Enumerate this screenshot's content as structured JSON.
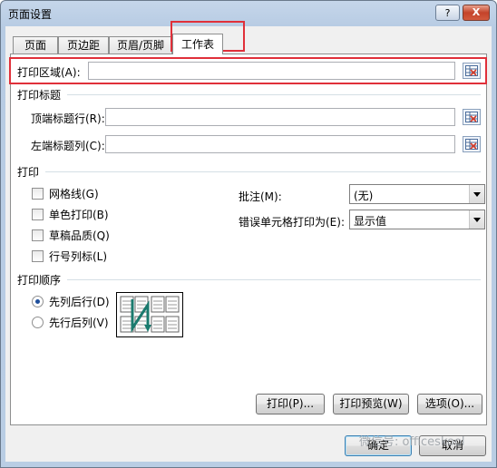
{
  "window": {
    "title": "页面设置",
    "help_label": "?",
    "close_label": "X"
  },
  "tabs": [
    {
      "label": "页面"
    },
    {
      "label": "页边距"
    },
    {
      "label": "页眉/页脚"
    },
    {
      "label": "工作表"
    }
  ],
  "print_area": {
    "label": "打印区域(A):",
    "value": ""
  },
  "print_titles": {
    "heading": "打印标题",
    "top_rows_label": "顶端标题行(R):",
    "top_rows_value": "",
    "left_cols_label": "左端标题列(C):",
    "left_cols_value": ""
  },
  "print": {
    "heading": "打印",
    "checkboxes": [
      {
        "label": "网格线(G)",
        "checked": false
      },
      {
        "label": "单色打印(B)",
        "checked": false
      },
      {
        "label": "草稿品质(Q)",
        "checked": false
      },
      {
        "label": "行号列标(L)",
        "checked": false
      }
    ],
    "comments_label": "批注(M):",
    "comments_value": "(无)",
    "errors_label": "错误单元格打印为(E):",
    "errors_value": "显示值"
  },
  "page_order": {
    "heading": "打印顺序",
    "option_down_then_over": "先列后行(D)",
    "option_over_then_down": "先行后列(V)",
    "selected": "down_then_over"
  },
  "buttons": {
    "print": "打印(P)...",
    "print_preview": "打印预览(W)",
    "options": "选项(O)...",
    "ok": "确定",
    "cancel": "取消"
  },
  "watermark": "微信号: officeskool",
  "colors": {
    "highlight": "#e0303a",
    "accent": "#1e4f9c"
  }
}
